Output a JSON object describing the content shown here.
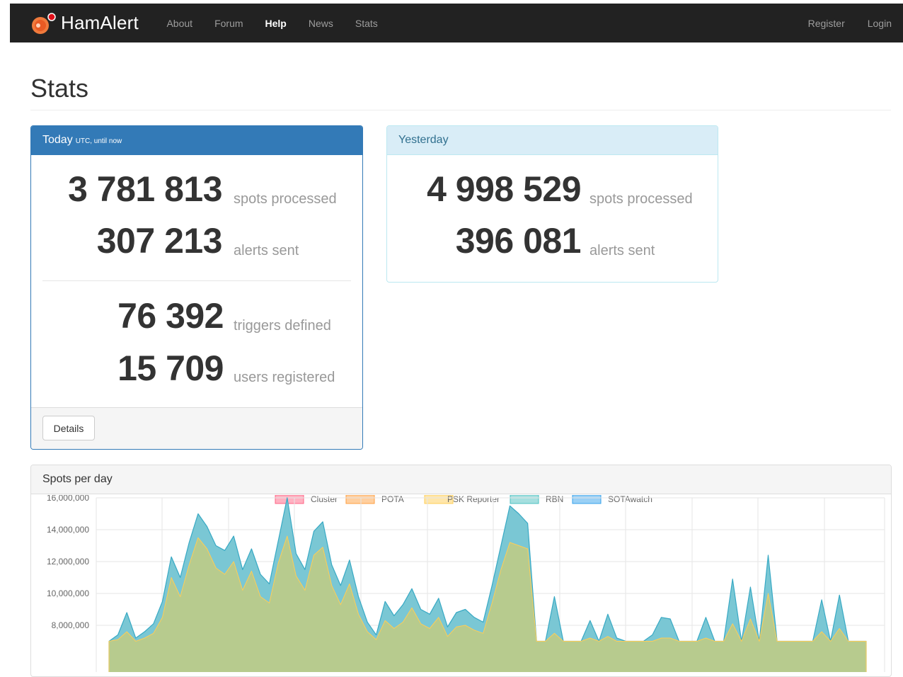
{
  "navbar": {
    "brand": "HamAlert",
    "links": [
      "About",
      "Forum",
      "Help",
      "News",
      "Stats"
    ],
    "active_index": 2,
    "right_links": [
      "Register",
      "Login"
    ]
  },
  "page": {
    "title": "Stats"
  },
  "today": {
    "heading": "Today",
    "heading_small": "UTC, until now",
    "spots_processed": "3 781 813",
    "spots_label": "spots processed",
    "alerts_sent": "307 213",
    "alerts_label": "alerts sent",
    "triggers_defined": "76 392",
    "triggers_label": "triggers defined",
    "users_registered": "15 709",
    "users_label": "users registered",
    "details_button": "Details"
  },
  "yesterday": {
    "heading": "Yesterday",
    "spots_processed": "4 998 529",
    "spots_label": "spots processed",
    "alerts_sent": "396 081",
    "alerts_label": "alerts sent"
  },
  "spots_panel": {
    "heading": "Spots per day"
  },
  "chart_data": {
    "type": "area",
    "stacked": true,
    "legend": [
      "Cluster",
      "POTA",
      "PSK Reporter",
      "RBN",
      "SOTAwatch"
    ],
    "legend_position": "top",
    "legend_colors": [
      {
        "fill": "#ffb1c1",
        "stroke": "#ff6384"
      },
      {
        "fill": "#ffcf9f",
        "stroke": "#ff9f40"
      },
      {
        "fill": "#ffe6aa",
        "stroke": "#ffcd56"
      },
      {
        "fill": "#a5dfdf",
        "stroke": "#4bc0c0"
      },
      {
        "fill": "#9ad0f5",
        "stroke": "#36a2eb"
      }
    ],
    "ytick_labels": [
      "16,000,000",
      "14,000,000",
      "12,000,000",
      "10,000,000",
      "8,000,000"
    ],
    "y_visible_range": [
      7500000,
      16000000
    ],
    "grid": true,
    "total": [
      7000000,
      7400000,
      8800000,
      7200000,
      7600000,
      8100000,
      9500000,
      12300000,
      11000000,
      13200000,
      15000000,
      14200000,
      13000000,
      12700000,
      13600000,
      11500000,
      12800000,
      11200000,
      10600000,
      13300000,
      16000000,
      12500000,
      11500000,
      13900000,
      14500000,
      11800000,
      10500000,
      12100000,
      9800000,
      8200000,
      7400000,
      9500000,
      8600000,
      9300000,
      10300000,
      9000000,
      8700000,
      9700000,
      7900000,
      8800000,
      9000000,
      8500000,
      8200000,
      10500000,
      13000000,
      15500000,
      15000000,
      14400000,
      7000000,
      7000000,
      9800000,
      7000000,
      7000000,
      7000000,
      8300000,
      7000000,
      8700000,
      7200000,
      7000000,
      7000000,
      7000000,
      7400000,
      8500000,
      8400000,
      7000000,
      7000000,
      7000000,
      8500000,
      7000000,
      7000000,
      10900000,
      7000000,
      10400000,
      7000000,
      12400000,
      7000000,
      7000000,
      7000000,
      7000000,
      7000000,
      9600000,
      7000000,
      9900000,
      7000000,
      7000000,
      7000000
    ],
    "cluster_pota_psk": [
      7000000,
      7100000,
      7600000,
      7000000,
      7200000,
      7500000,
      8500000,
      11000000,
      9800000,
      11800000,
      13500000,
      12800000,
      11600000,
      11200000,
      12000000,
      10200000,
      11400000,
      9800000,
      9400000,
      11900000,
      13600000,
      11100000,
      10200000,
      12400000,
      12900000,
      10500000,
      9300000,
      10600000,
      8700000,
      7600000,
      7100000,
      8300000,
      7800000,
      8200000,
      9100000,
      8100000,
      7800000,
      8500000,
      7300000,
      7900000,
      8000000,
      7700000,
      7500000,
      9400000,
      11500000,
      13200000,
      13000000,
      12800000,
      7000000,
      7000000,
      7500000,
      7000000,
      7000000,
      7000000,
      7200000,
      7000000,
      7300000,
      7000000,
      7000000,
      7000000,
      7000000,
      7000000,
      7200000,
      7200000,
      7000000,
      7000000,
      7000000,
      7200000,
      7000000,
      7000000,
      8100000,
      7000000,
      8400000,
      7000000,
      10000000,
      7000000,
      7000000,
      7000000,
      7000000,
      7000000,
      7600000,
      7000000,
      7800000,
      7000000,
      7000000,
      7000000
    ]
  }
}
